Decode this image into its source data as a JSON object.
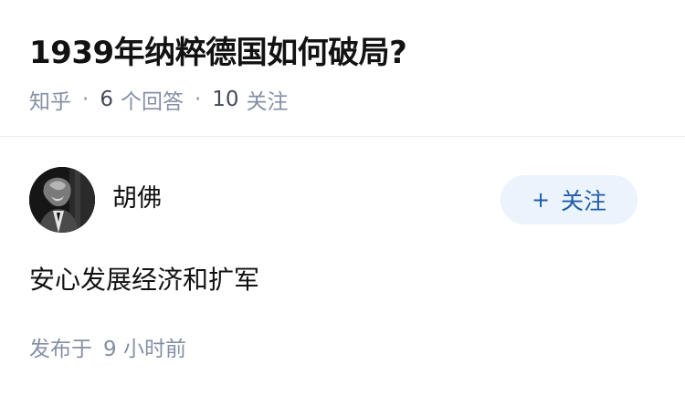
{
  "question": {
    "title": "1939年纳粹德国如何破局?",
    "source": "知乎",
    "answer_count": "6",
    "answer_label": "个回答",
    "follower_count": "10",
    "follower_label": "关注"
  },
  "answer": {
    "author_name": "胡佛",
    "follow_button_label": "关注",
    "follow_button_icon": "plus-icon",
    "content": "安心发展经济和扩军",
    "publish_prefix": "发布于",
    "publish_time": "9 小时前"
  },
  "colors": {
    "meta_text": "#8590a6",
    "follow_button_bg": "#ebf3fc",
    "follow_button_text": "#1f5ea8",
    "divider": "#ebebeb"
  }
}
